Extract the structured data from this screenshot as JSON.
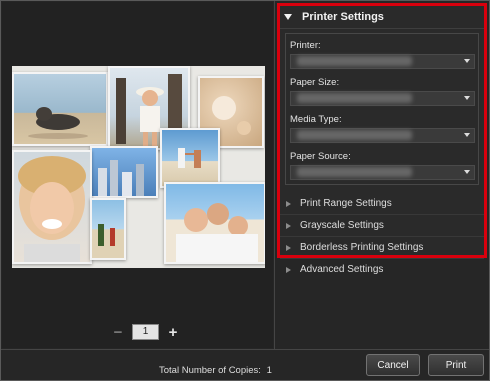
{
  "printer_settings": {
    "title": "Printer Settings",
    "fields": [
      {
        "label": "Printer:"
      },
      {
        "label": "Paper Size:"
      },
      {
        "label": "Media Type:"
      },
      {
        "label": "Paper Source:"
      }
    ]
  },
  "sections": [
    {
      "label": "Print Range Settings"
    },
    {
      "label": "Grayscale Settings"
    },
    {
      "label": "Borderless Printing Settings"
    },
    {
      "label": "Advanced Settings"
    }
  ],
  "page": {
    "current": "1"
  },
  "footer": {
    "copies_label": "Total Number of Copies:",
    "copies_value": "1",
    "cancel_label": "Cancel",
    "print_label": "Print"
  },
  "colors": {
    "highlight_border": "#d9000d",
    "background": "#262626"
  },
  "icons": [
    "expanded-triangle-icon",
    "collapsed-triangle-icon",
    "dropdown-arrow-icon",
    "minus-icon",
    "plus-icon"
  ]
}
